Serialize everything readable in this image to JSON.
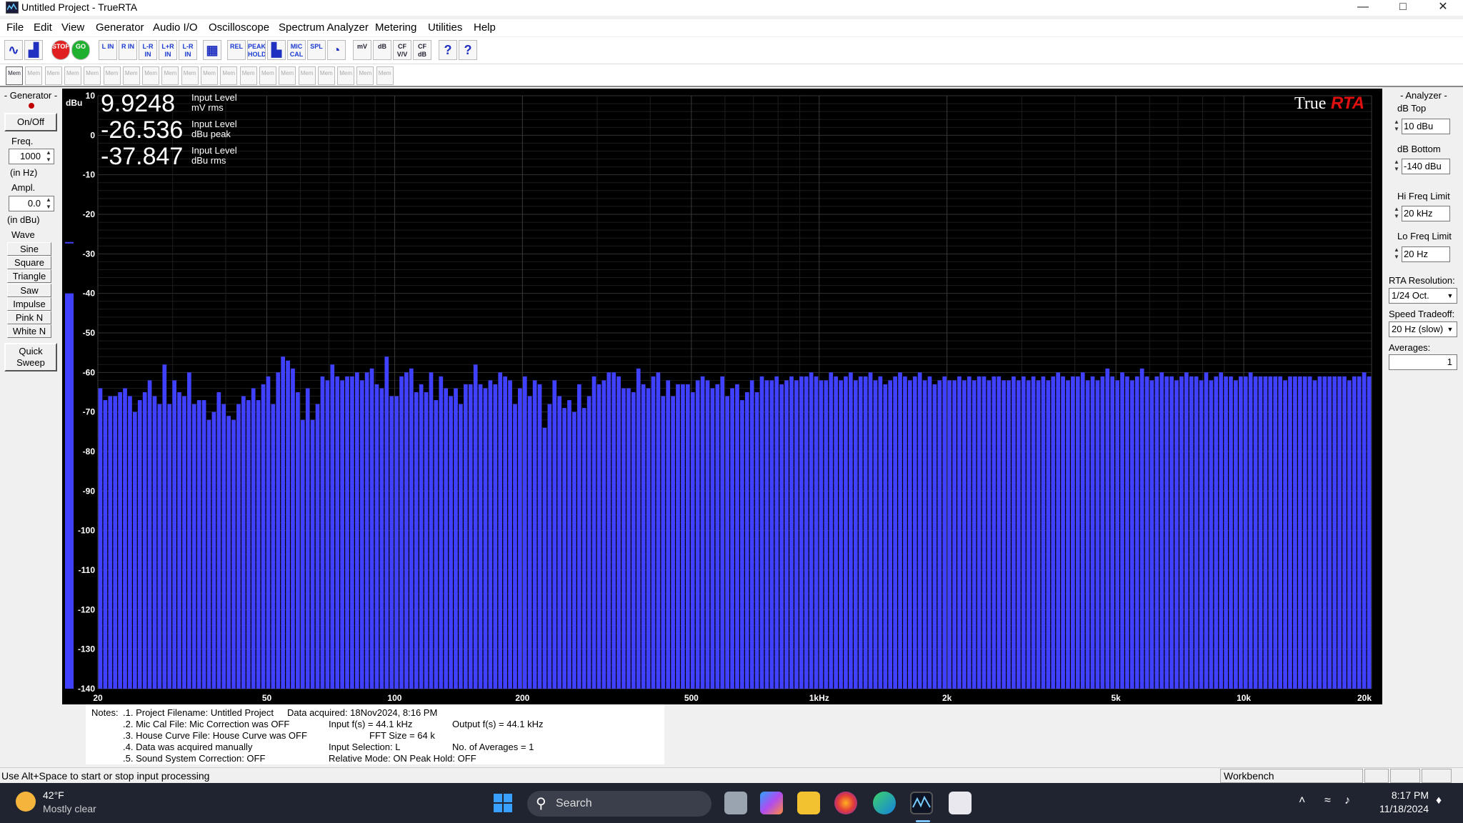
{
  "window": {
    "title": "Untitled Project - TrueRTA"
  },
  "menu": [
    "File",
    "Edit",
    "View",
    "Generator",
    "Audio I/O",
    "Oscilloscope",
    "Spectrum Analyzer",
    "Metering",
    "Utilities",
    "Help"
  ],
  "toolbar": {
    "tools": [
      "sine-icon",
      "spectrum-icon",
      "STOP",
      "GO",
      "L IN",
      "R IN",
      "L-R IN",
      "L+R IN",
      "L-R IN",
      "grid-icon",
      "REL",
      "PEAK HOLD",
      "bars-icon",
      "MIC CAL",
      "SPL",
      "gauge-icon",
      "mV",
      "dB",
      "CF V/V",
      "CF dB",
      "help-icon",
      "context-help-icon"
    ],
    "mem_label": "Mem",
    "mem_slots": 20
  },
  "generator": {
    "title": "- Generator -",
    "onoff": "On/Off",
    "freq_label": "Freq.",
    "freq_value": "1000",
    "freq_unit": "(in Hz)",
    "ampl_label": "Ampl.",
    "ampl_value": "0.0",
    "ampl_unit": "(in dBu)",
    "wave_label": "Wave",
    "waves": [
      "Sine",
      "Square",
      "Triangle",
      "Saw",
      "Impulse",
      "Pink N",
      "White N"
    ],
    "quick_sweep": [
      "Quick",
      "Sweep"
    ],
    "led_color": "#c00000"
  },
  "readouts": [
    {
      "value": "9.9248",
      "label1": "Input Level",
      "label2": "mV rms"
    },
    {
      "value": "-26.536",
      "label1": "Input Level",
      "label2": "dBu peak"
    },
    {
      "value": "-37.847",
      "label1": "Input Level",
      "label2": "dBu rms"
    }
  ],
  "logo": {
    "true": "True",
    "rta": "RTA"
  },
  "analyzer": {
    "title": "- Analyzer -",
    "db_top_label": "dB Top",
    "db_top": "10 dBu",
    "db_bottom_label": "dB Bottom",
    "db_bottom": "-140 dBu",
    "hi_label": "Hi Freq Limit",
    "hi": "20 kHz",
    "lo_label": "Lo Freq Limit",
    "lo": "20 Hz",
    "res_label": "RTA Resolution:",
    "res": "1/24 Oct.",
    "speed_label": "Speed Tradeoff:",
    "speed": "20 Hz (slow)",
    "avg_label": "Averages:",
    "avg": "1"
  },
  "notes": {
    "label": "Notes:",
    "lines": [
      ".1. Project Filename: Untitled Project",
      ".2. Mic Cal File: Mic Correction was OFF",
      ".3. House Curve File: House Curve was OFF",
      ".4. Data was acquired manually",
      ".5. Sound System Correction: OFF"
    ],
    "col2": [
      "Data acquired: 18Nov2024, 8:16 PM",
      "Input f(s) = 44.1 kHz",
      "FFT Size = 64 k",
      "Input Selection: L",
      "Relative Mode: ON  Peak Hold: OFF"
    ],
    "col3": [
      "Output f(s) = 44.1 kHz",
      "No. of Averages = 1"
    ]
  },
  "status": {
    "text": "Use Alt+Space to start or stop input processing",
    "cell": "Workbench"
  },
  "taskbar": {
    "temp": "42°F",
    "weather": "Mostly clear",
    "search": "Search",
    "time": "8:17 PM",
    "date": "11/18/2024"
  },
  "chart_data": {
    "type": "bar",
    "ylabel": "dBu",
    "ylim": [
      -140,
      10
    ],
    "yticks": [
      10,
      0,
      -10,
      -20,
      -30,
      -40,
      -50,
      -60,
      -70,
      -80,
      -90,
      -100,
      -110,
      -120,
      -130,
      -140
    ],
    "xlim": [
      20,
      20000
    ],
    "xscale": "log",
    "xticks": [
      {
        "v": 20,
        "label": "20"
      },
      {
        "v": 50,
        "label": "50"
      },
      {
        "v": 100,
        "label": "100"
      },
      {
        "v": 200,
        "label": "200"
      },
      {
        "v": 500,
        "label": "500"
      },
      {
        "v": 1000,
        "label": "1kHz"
      },
      {
        "v": 2000,
        "label": "2k"
      },
      {
        "v": 5000,
        "label": "5k"
      },
      {
        "v": 10000,
        "label": "10k"
      },
      {
        "v": 20000,
        "label": "20k"
      }
    ],
    "bar_color": "#4040ff",
    "level_meter_db": -40,
    "level_meter_peak_db": -27,
    "values": [
      -64,
      -67,
      -66,
      -66,
      -65,
      -64,
      -66,
      -70,
      -67,
      -65,
      -62,
      -66,
      -68,
      -58,
      -68,
      -62,
      -65,
      -66,
      -60,
      -68,
      -67,
      -67,
      -72,
      -70,
      -65,
      -68,
      -71,
      -72,
      -68,
      -66,
      -67,
      -64,
      -67,
      -63,
      -61,
      -68,
      -60,
      -56,
      -57,
      -59,
      -65,
      -72,
      -64,
      -72,
      -68,
      -61,
      -62,
      -58,
      -61,
      -62,
      -61,
      -61,
      -60,
      -62,
      -60,
      -59,
      -63,
      -64,
      -56,
      -66,
      -66,
      -61,
      -60,
      -59,
      -65,
      -63,
      -65,
      -60,
      -67,
      -61,
      -64,
      -66,
      -64,
      -68,
      -63,
      -63,
      -58,
      -63,
      -64,
      -62,
      -63,
      -60,
      -61,
      -62,
      -68,
      -64,
      -61,
      -66,
      -62,
      -63,
      -74,
      -68,
      -62,
      -66,
      -69,
      -67,
      -70,
      -63,
      -69,
      -66,
      -61,
      -63,
      -62,
      -60,
      -60,
      -61,
      -64,
      -64,
      -65,
      -59,
      -63,
      -64,
      -61,
      -60,
      -66,
      -62,
      -66,
      -63,
      -63,
      -63,
      -65,
      -62,
      -61,
      -62,
      -64,
      -63,
      -61,
      -66,
      -64,
      -63,
      -67,
      -65,
      -62,
      -65,
      -61,
      -62,
      -62,
      -61,
      -63,
      -62,
      -61,
      -62,
      -61,
      -61,
      -60,
      -61,
      -62,
      -62,
      -60,
      -61,
      -62,
      -61,
      -60,
      -62,
      -61,
      -61,
      -60,
      -62,
      -61,
      -63,
      -62,
      -61,
      -60,
      -61,
      -62,
      -61,
      -60,
      -62,
      -61,
      -63,
      -62,
      -61,
      -62,
      -62,
      -61,
      -62,
      -61,
      -62,
      -61,
      -61,
      -62,
      -61,
      -61,
      -62,
      -62,
      -61,
      -62,
      -61,
      -62,
      -61,
      -62,
      -61,
      -62,
      -61,
      -60,
      -61,
      -62,
      -61,
      -61,
      -60,
      -62,
      -61,
      -62,
      -61,
      -59,
      -61,
      -62,
      -60,
      -61,
      -62,
      -61,
      -59,
      -61,
      -62,
      -61,
      -60,
      -61,
      -61,
      -62,
      -61,
      -60,
      -61,
      -61,
      -62,
      -60,
      -62,
      -61,
      -60,
      -61,
      -61,
      -62,
      -61,
      -61,
      -60,
      -61,
      -61,
      -61,
      -61,
      -61,
      -61,
      -62,
      -61,
      -61,
      -61,
      -61,
      -61,
      -62,
      -61,
      -61,
      -61,
      -61,
      -61,
      -61,
      -62,
      -61,
      -61,
      -60,
      -61
    ]
  }
}
